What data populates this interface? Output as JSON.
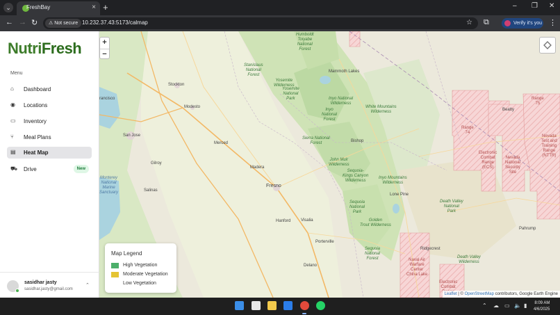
{
  "browser": {
    "tab_title": "FreshBay",
    "new_tab_label": "+",
    "tab_close_label": "×",
    "security_label": "Not secure",
    "url": "10.232.37.43:5173/calmap",
    "verify_label": "Verify it's you",
    "window_controls": {
      "minimize": "–",
      "restore": "❐",
      "close": "✕"
    }
  },
  "sidebar": {
    "logo_part1": "Nutri",
    "logo_part2": "Fresh",
    "menu_heading": "Menu",
    "items": [
      {
        "label": "Dashboard",
        "icon": "home-icon",
        "active": false
      },
      {
        "label": "Locations",
        "icon": "pin-icon",
        "active": false
      },
      {
        "label": "Inventory",
        "icon": "inbox-icon",
        "active": false
      },
      {
        "label": "Meal Plans",
        "icon": "utensils-icon",
        "active": false
      },
      {
        "label": "Heat Map",
        "icon": "map-icon",
        "active": true
      },
      {
        "label": "Drive",
        "icon": "truck-icon",
        "active": false,
        "badge": "New"
      }
    ],
    "user": {
      "name": "sasidhar jasty",
      "email": "sasidhar.jasty@gmail.com"
    }
  },
  "map": {
    "zoom_in": "+",
    "zoom_out": "−",
    "legend": {
      "title": "Map Legend",
      "items": [
        {
          "label": "High Vegetation",
          "color": "#4caf6a"
        },
        {
          "label": "Moderate Vegetation",
          "color": "#e5c433"
        },
        {
          "label": "Low Vegetation",
          "color": "#ffffff"
        }
      ]
    },
    "attribution": {
      "leaflet": "Leaflet",
      "separator": "| ©",
      "osm": "OpenStreetMap",
      "rest": "contributors, Google Earth Engine"
    },
    "labels": {
      "humboldt": "Humboldt\nToiyabe\nNational\nForest",
      "stanislaus": "Stanislaus\nNational\nForest",
      "yosemite_wild": "Yosemite\nWilderness",
      "yosemite_park": "Yosemite\nNational\nPark",
      "inyo_wild": "Inyo National\nWilderness",
      "white_mountains": "White Mountains\nWilderness",
      "inyo_forest": "Inyo\nNational\nForest",
      "sierra": "Sierra National\nForest",
      "john_muir": "John Muir\nWilderness",
      "sequoia_kings": "Sequoia-\nKings Canyon\nWilderness",
      "inyo_mountains": "Inyo Mountains\nWilderness",
      "sequoia_park": "Sequoia\nNational\nPark",
      "golden_trout": "Golden\nTrout Wilderness",
      "sequoia_forest": "Sequoia\nNational\nForest",
      "death_valley_park": "Death Valley\nNational\nPark",
      "death_valley_wild": "Death Valley\nWilderness",
      "nevada_test": "Nevada\nTest and\nTraining\nRange\n(NTTR)",
      "nevada_security": "Nevada\nNational\nSecurity\nSite",
      "naval_air": "Naval Air\nWarfare\nCenter\nChina Lake",
      "range_74": "Range\n74",
      "electronic_combat": "Electronic\nCombat\nRange\n(ECS)",
      "electronic_combat2": "Electronic\nCombat\nRange",
      "fresno": "Fresno",
      "san_jose": "San Jose",
      "stockton": "Stockton",
      "modesto": "Modesto",
      "merced": "Merced",
      "madera": "Madera",
      "hanford": "Hanford",
      "visalia": "Visalia",
      "porterville": "Porterville",
      "delano": "Delano",
      "monterey": "Monterey\nNational\nMarine\nSanctuary",
      "pahrump": "Pahrump",
      "gilroy": "Gilroy",
      "salinas": "Salinas",
      "francisco": "rancisco",
      "mammoth": "Mammoth Lakes",
      "bishop": "Bishop",
      "lone_pine": "Lone Pine",
      "ridgecrest": "Ridgecrest",
      "beatty": "Beatty",
      "range_75": "Range\n75"
    }
  },
  "taskbar": {
    "time": "8:09 AM",
    "date": "4/6/2025"
  }
}
